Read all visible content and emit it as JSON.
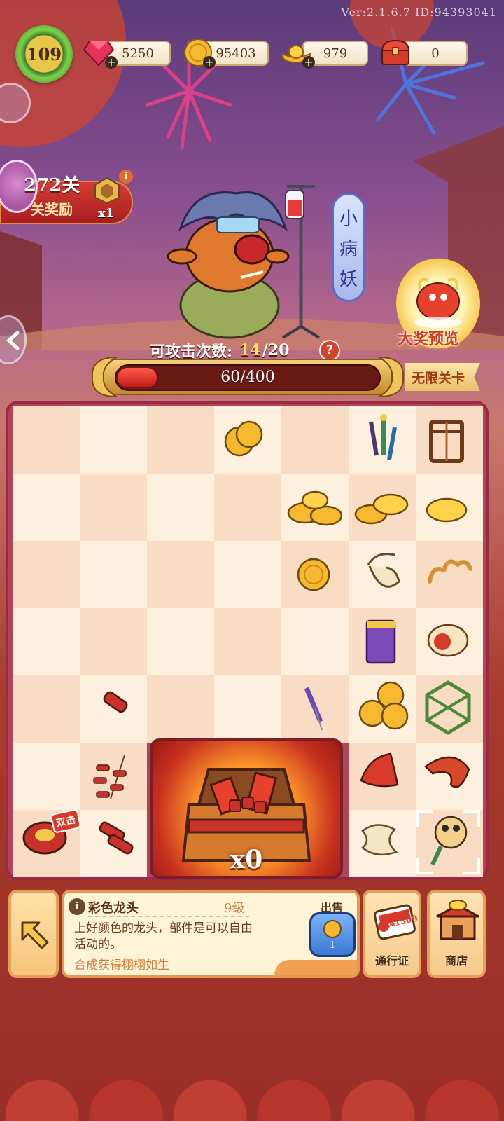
{
  "version": "Ver:2.1.6.7 ID:94393041",
  "player": {
    "level": "109"
  },
  "resources": [
    {
      "name": "gem",
      "value": "5250",
      "icon": "gem-icon"
    },
    {
      "name": "coin",
      "value": "95403",
      "icon": "coin-icon"
    },
    {
      "name": "gold_ingot",
      "value": "979",
      "icon": "gold-ingot-icon"
    },
    {
      "name": "chest",
      "value": "0",
      "icon": "treasure-chest-icon"
    }
  ],
  "stage": {
    "number": "272关",
    "reward_label": "关奖励",
    "reward_count": "x1"
  },
  "boss": {
    "name_chars": [
      "小",
      "病",
      "妖"
    ]
  },
  "prize_preview": {
    "label": "大奖预览"
  },
  "attack": {
    "label": "可攻击次数:",
    "current": "14",
    "max": "/20"
  },
  "hp": {
    "text": "60/400",
    "fraction": 0.15
  },
  "endless": {
    "label": "无限关卡"
  },
  "board": {
    "double_hit_badge": "双击",
    "chest_count": "x0"
  },
  "item_info": {
    "name": "彩色龙头",
    "level": "9级",
    "description": "上好颜色的龙头，部件是可以自由活动的。",
    "source": "合成获得栩栩如生",
    "sell_label": "出售",
    "sell_price": "1"
  },
  "tools": [
    {
      "label": "通行证",
      "badge": "%1300"
    },
    {
      "label": "商店"
    }
  ],
  "colors": {
    "accent": "#d63a1a",
    "panel": "#fdf3d7",
    "gold": "#f5c84a"
  }
}
